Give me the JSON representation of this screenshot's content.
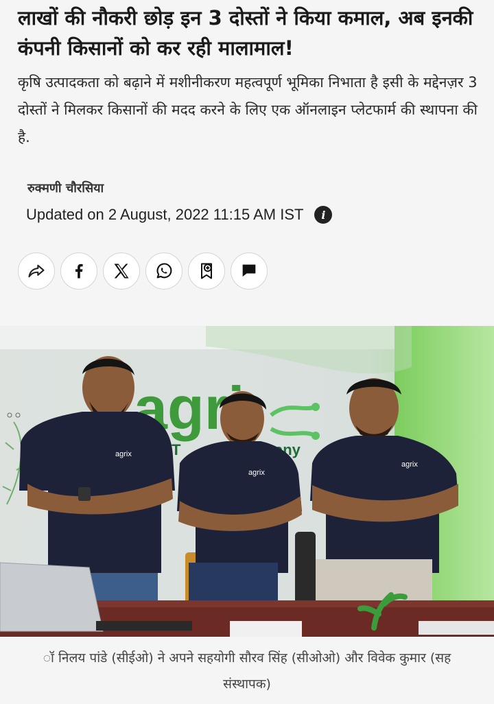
{
  "article": {
    "headline": "लाखों की नौकरी छोड़ इन 3 दोस्तों ने किया कमाल, अब इनकी कंपनी किसानों को कर रही मालामाल!",
    "summary": "कृषि उत्पादकता को बढ़ाने में मशीनीकरण महत्वपूर्ण भूमिका निभाता है इसी के मद्देनज़र 3 दोस्तों ने मिलकर किसानों की मदद करने के लिए एक ऑनलाइन प्लेटफार्म की स्थापना की है.",
    "author": "रुक्मणी चौरसिया",
    "updated": "Updated on 2 August, 2022 11:15 AM IST"
  },
  "share_buttons": [
    {
      "icon": "share-icon"
    },
    {
      "icon": "facebook-icon"
    },
    {
      "icon": "x-icon"
    },
    {
      "icon": "whatsapp-icon"
    },
    {
      "icon": "bookmark-add-icon"
    },
    {
      "icon": "comment-icon"
    }
  ],
  "photo": {
    "wall_logo_text": "agri",
    "wall_tagline_left": "T",
    "wall_tagline_right": "any",
    "shirt_logo": "agrix"
  },
  "caption": {
    "line1": "ॉ निलय पांडे (सीईओ) ने अपने सहयोगी सौरव सिंह (सीओओ) और विवेक कुमार (सह",
    "line2": "संस्थापक)"
  },
  "colors": {
    "accent_green": "#3db14a",
    "shirt_navy": "#1d2238",
    "page_bg": "#f5f5f5"
  }
}
